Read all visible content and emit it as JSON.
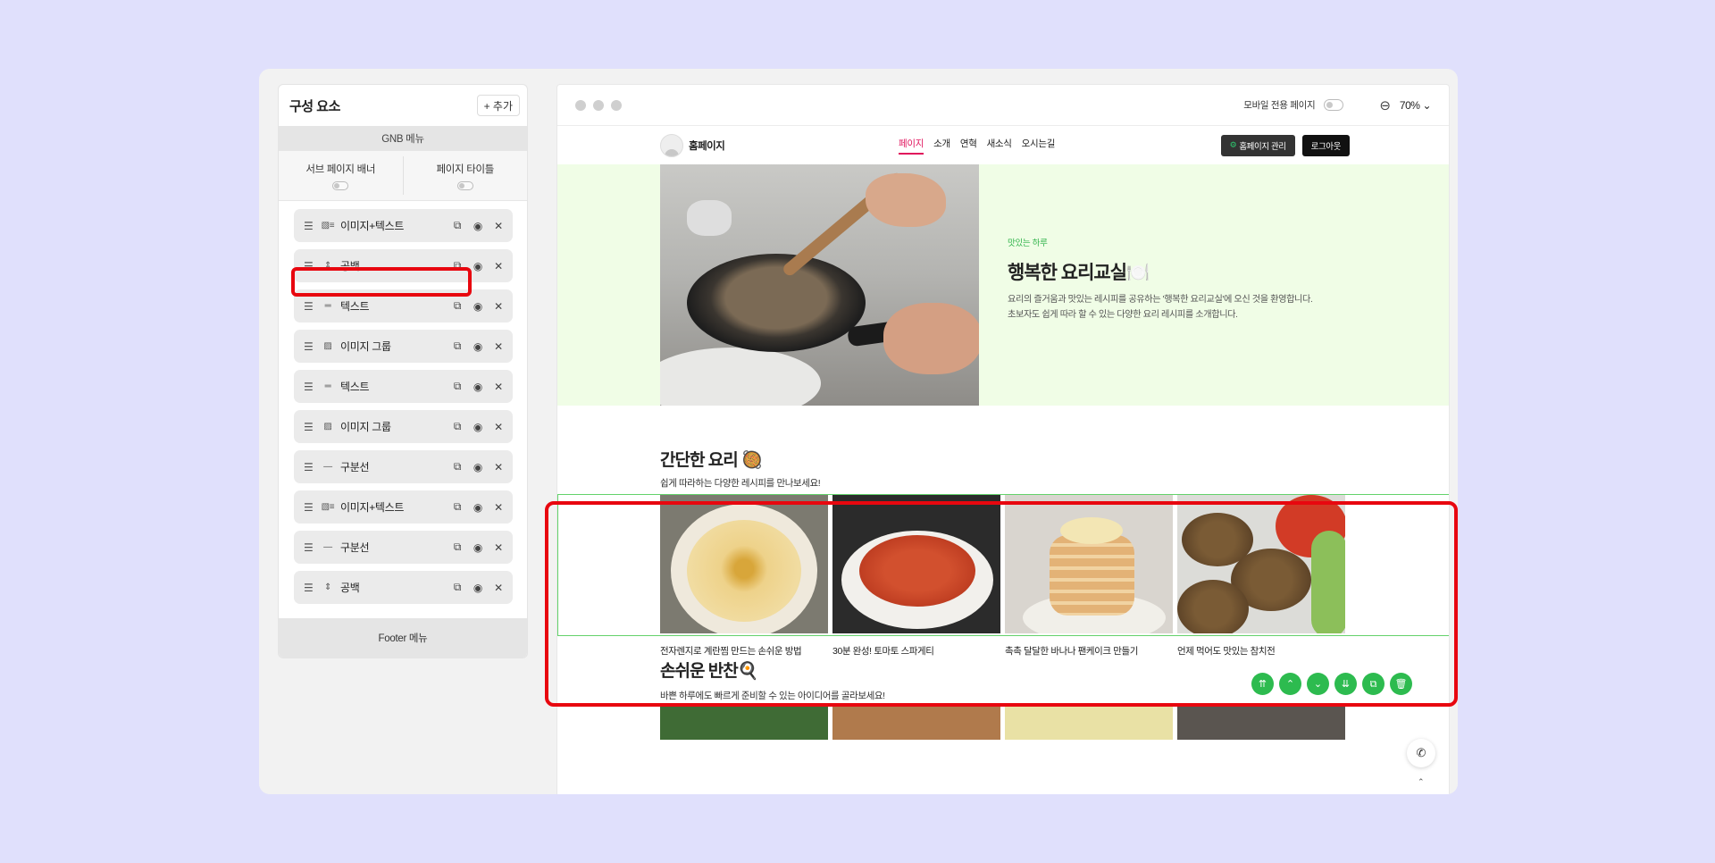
{
  "left_panel": {
    "title": "구성 요소",
    "add_label": "+ 추가",
    "gnb_label": "GNB 메뉴",
    "toggle_sub_banner": "서브 페이지 배너",
    "toggle_page_title": "페이지 타이틀",
    "components": [
      {
        "label": "이미지+텍스트",
        "icon": "image-text-icon"
      },
      {
        "label": "공백",
        "icon": "spacer-icon"
      },
      {
        "label": "텍스트",
        "icon": "text-icon"
      },
      {
        "label": "이미지 그룹",
        "icon": "image-group-icon",
        "selected": true
      },
      {
        "label": "텍스트",
        "icon": "text-icon"
      },
      {
        "label": "이미지 그룹",
        "icon": "image-group-icon"
      },
      {
        "label": "구분선",
        "icon": "divider-icon"
      },
      {
        "label": "이미지+텍스트",
        "icon": "image-text-icon"
      },
      {
        "label": "구분선",
        "icon": "divider-icon"
      },
      {
        "label": "공백",
        "icon": "spacer-icon"
      }
    ],
    "footer_label": "Footer 메뉴"
  },
  "preview_bar": {
    "mobile_only_label": "모바일 전용 페이지",
    "zoom": "70%"
  },
  "site": {
    "brand": "홈페이지",
    "menu": [
      "페이지",
      "소개",
      "연혁",
      "새소식",
      "오시는길"
    ],
    "active_menu": "페이지",
    "manage_button": "홈페이지 관리",
    "logout_button": "로그아웃",
    "hero": {
      "kicker": "맛있는 하루",
      "title": "행복한 요리교실🍽️",
      "desc_line1": "요리의 즐거움과 맛있는 레시피를 공유하는 '행복한 요리교실'에 오신 것을 환영합니다.",
      "desc_line2": "초보자도 쉽게 따라 할 수 있는 다양한 요리 레시피를 소개합니다."
    },
    "section1": {
      "title": "간단한 요리 🥘",
      "subtitle": "쉽게 따라하는 다양한 레시피를 만나보세요!",
      "cards": [
        "전자렌지로 계란찜 만드는 손쉬운 방법",
        "30분 완성! 토마토 스파게티",
        "촉촉 달달한 바나나 팬케이크 만들기",
        "언제 먹어도 맛있는 참치전"
      ]
    },
    "section2": {
      "title": "손쉬운 반찬🍳",
      "subtitle": "바쁜 하루에도 빠르게 준비할 수 있는 아이디어를 골라보세요!"
    }
  },
  "colors": {
    "selection_red": "#e8070f",
    "accent_green": "#2dbb4f",
    "active_menu": "#e0135c",
    "hero_bg": "#f0fde6"
  }
}
